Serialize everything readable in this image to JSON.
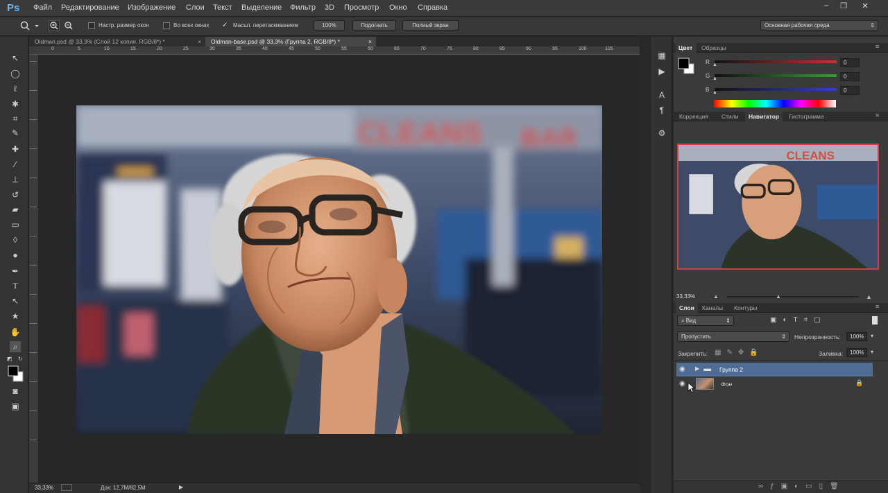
{
  "app": {
    "logo": "Ps"
  },
  "menu": [
    "Файл",
    "Редактирование",
    "Изображение",
    "Слои",
    "Текст",
    "Выделение",
    "Фильтр",
    "3D",
    "Просмотр",
    "Окно",
    "Справка"
  ],
  "window_buttons": [
    "–",
    "❐",
    "✕"
  ],
  "options": {
    "resize_windows": "Настр. размер окон",
    "all_windows": "Во всех окнах",
    "scrubby_zoom": "Масшт. перетаскиванием",
    "zoom_value": "100%",
    "fit_btn": "Подогнать",
    "fullscreen_btn": "Полный экран",
    "workspace": "Основная рабочая среда"
  },
  "tabs": [
    {
      "label": "Oldman.psd @ 33,3% (Слой 12 копия, RGB/8*) *",
      "active": false
    },
    {
      "label": "Oldman-base.psd @ 33,3% (Группа 2, RGB/8*) *",
      "active": true
    }
  ],
  "ruler_numbers": [
    "0",
    "5",
    "10",
    "15",
    "20",
    "25",
    "30",
    "35",
    "40",
    "45",
    "50",
    "55",
    "60",
    "65",
    "70",
    "75",
    "80",
    "85",
    "90",
    "95",
    "100",
    "105"
  ],
  "status": {
    "zoom": "33,33%",
    "doc": "Док: 12,7M/82,5M"
  },
  "color_panel": {
    "tabs": [
      "Цвет",
      "Образцы"
    ],
    "channels": [
      {
        "label": "R",
        "value": "0",
        "color": "#d03030"
      },
      {
        "label": "G",
        "value": "0",
        "color": "#30a030"
      },
      {
        "label": "B",
        "value": "0",
        "color": "#3040d0"
      }
    ]
  },
  "nav_panel": {
    "tabs": [
      "Коррекция",
      "Стили",
      "Навигатор",
      "Гистограмма"
    ],
    "zoom": "33.33%"
  },
  "layers_panel": {
    "tabs": [
      "Слои",
      "Каналы",
      "Контуры"
    ],
    "filter": "Вид",
    "blend_mode": "Пропустить",
    "opacity_label": "Непрозрачность:",
    "opacity": "100%",
    "lock_label": "Закрепить:",
    "fill_label": "Заливка:",
    "fill": "100%",
    "layers": [
      {
        "name": "Группа 2",
        "type": "group",
        "selected": true
      },
      {
        "name": "Фон",
        "type": "layer",
        "selected": false
      }
    ]
  },
  "colors": {
    "accent": "#4f6d94",
    "nav_frame": "#d04040"
  }
}
